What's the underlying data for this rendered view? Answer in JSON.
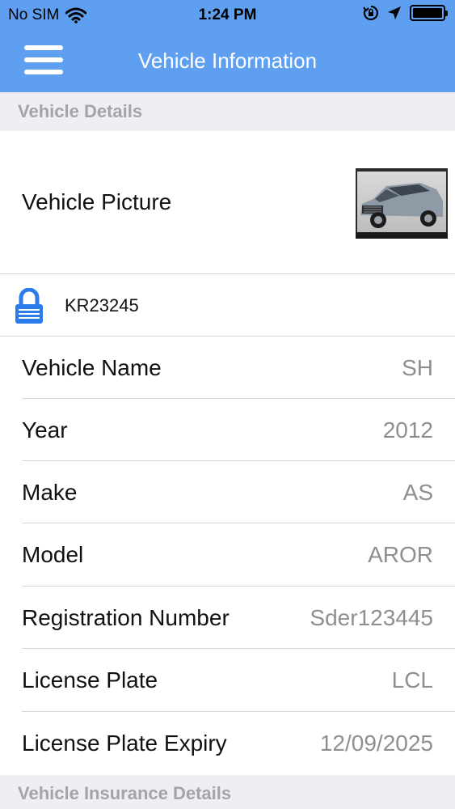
{
  "status_bar": {
    "carrier": "No SIM",
    "time": "1:24 PM"
  },
  "nav": {
    "title": "Vehicle Information"
  },
  "sections": {
    "vehicle_details": "Vehicle Details",
    "insurance_details": "Vehicle Insurance Details"
  },
  "picture": {
    "label": "Vehicle Picture"
  },
  "lock_row": {
    "text": "KR23245"
  },
  "fields": [
    {
      "label": "Vehicle Name",
      "value": "SH"
    },
    {
      "label": "Year",
      "value": "2012"
    },
    {
      "label": "Make",
      "value": "AS"
    },
    {
      "label": "Model",
      "value": "AROR"
    },
    {
      "label": "Registration Number",
      "value": "Sder123445"
    },
    {
      "label": "License Plate",
      "value": "LCL"
    },
    {
      "label": "License Plate Expiry",
      "value": "12/09/2025"
    }
  ],
  "colors": {
    "header": "#5f9ff0",
    "section_bg": "#efeff3",
    "value_text": "#8e8e93",
    "lock_icon": "#2b7be8"
  },
  "icons": [
    "wifi-icon",
    "orientation-lock-icon",
    "location-arrow-icon",
    "battery-icon",
    "menu-icon",
    "lock-icon"
  ]
}
